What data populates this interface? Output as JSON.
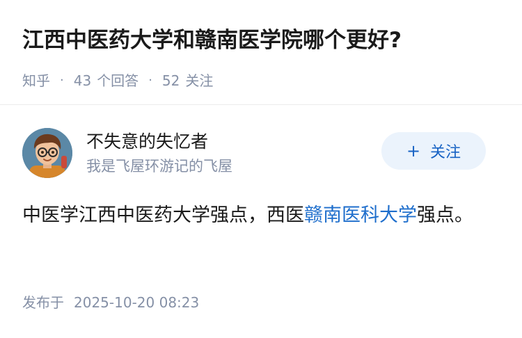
{
  "question": {
    "title": "江西中医药大学和赣南医学院哪个更好?",
    "source": "知乎",
    "separator": "·",
    "answer_count": "43",
    "answer_label": "个回答",
    "follower_count": "52",
    "follower_label": "关注"
  },
  "answer": {
    "author": {
      "name": "不失意的失忆者",
      "bio": "我是飞屋环游记的飞屋",
      "avatar_icon": "cartoon-boy-avatar"
    },
    "follow_button": {
      "icon": "plus-icon",
      "plus": "+",
      "label": "关注"
    },
    "content": {
      "text_before": "中医学江西中医药大学强点，西医",
      "link_text": "赣南医科大学",
      "text_after": "强点。"
    },
    "published_label": "发布于",
    "published_time": "2025-10-20 08:23"
  },
  "colors": {
    "accent": "#1863c4",
    "link": "#1e6ecc",
    "muted": "#8590a6",
    "follow_bg": "#ebf3fc"
  }
}
